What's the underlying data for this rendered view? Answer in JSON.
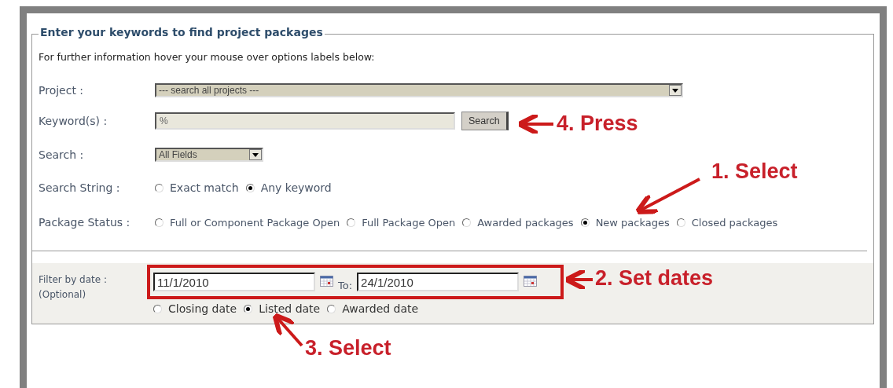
{
  "form": {
    "title": "Enter your keywords to find project packages",
    "info": "For further information hover your mouse over options labels below:",
    "project": {
      "label": "Project :",
      "value": "--- search all projects ---"
    },
    "keywords": {
      "label": "Keyword(s) :",
      "value": "%",
      "button": "Search"
    },
    "search": {
      "label": "Search :",
      "value": "All Fields"
    },
    "search_string": {
      "label": "Search String :",
      "options": [
        {
          "label": "Exact match",
          "selected": false
        },
        {
          "label": "Any keyword",
          "selected": true
        }
      ]
    },
    "package_status": {
      "label": "Package Status :",
      "options": [
        {
          "label": "Full or Component Package Open",
          "selected": false
        },
        {
          "label": "Full Package Open",
          "selected": false
        },
        {
          "label": "Awarded packages",
          "selected": false
        },
        {
          "label": "New packages",
          "selected": true
        },
        {
          "label": "Closed packages",
          "selected": false
        }
      ]
    },
    "filter": {
      "label": "Filter by date :",
      "sublabel": "(Optional)",
      "from": "11/1/2010",
      "to_label": "To:",
      "to": "24/1/2010",
      "options": [
        {
          "label": "Closing date",
          "selected": false
        },
        {
          "label": "Listed date",
          "selected": true
        },
        {
          "label": "Awarded date",
          "selected": false
        }
      ]
    }
  },
  "annotations": [
    {
      "text": "4. Press"
    },
    {
      "text": "1. Select"
    },
    {
      "text": "2. Set dates"
    },
    {
      "text": "3. Select"
    }
  ]
}
